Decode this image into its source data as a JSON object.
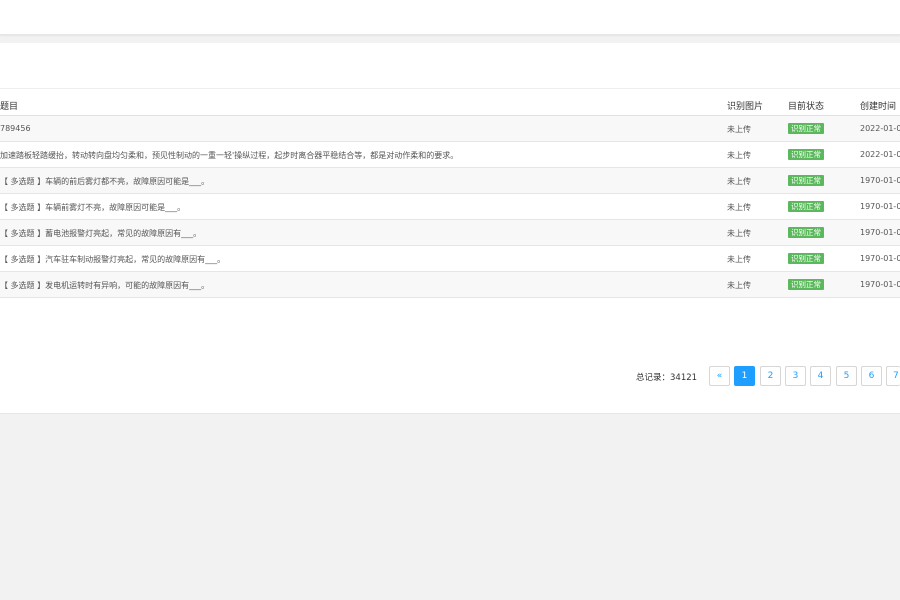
{
  "table": {
    "headers": {
      "title": "题目",
      "image": "识别图片",
      "status": "目前状态",
      "created": "创建时间"
    },
    "rows": [
      {
        "title": "789456",
        "image": "未上传",
        "status": "识别正常",
        "created": "2022-01-0"
      },
      {
        "title": "加速踏板轻踏缓抬，转动转向盘均匀柔和，预见性制动的一重一轻'操纵过程，起步时离合器平稳结合等，都是对动作柔和的要求。",
        "image": "未上传",
        "status": "识别正常",
        "created": "2022-01-0"
      },
      {
        "title": "【 多选题 】车辆的前后雾灯都不亮，故障原因可能是___。",
        "image": "未上传",
        "status": "识别正常",
        "created": "1970-01-0"
      },
      {
        "title": "【 多选题 】车辆前雾灯不亮，故障原因可能是___。",
        "image": "未上传",
        "status": "识别正常",
        "created": "1970-01-0"
      },
      {
        "title": "【 多选题 】蓄电池报警灯亮起，常见的故障原因有___。",
        "image": "未上传",
        "status": "识别正常",
        "created": "1970-01-0"
      },
      {
        "title": "【 多选题 】汽车驻车制动报警灯亮起，常见的故障原因有___。",
        "image": "未上传",
        "status": "识别正常",
        "created": "1970-01-0"
      },
      {
        "title": "【 多选题 】发电机运转时有异响，可能的故障原因有___。",
        "image": "未上传",
        "status": "识别正常",
        "created": "1970-01-0"
      }
    ]
  },
  "pagination": {
    "total_label": "总记录：34121",
    "prev": "«",
    "pages": [
      "1",
      "2",
      "3",
      "4",
      "5",
      "6",
      "7"
    ],
    "current": "1"
  },
  "colors": {
    "accent": "#1e9fff",
    "status_ok": "#5cb85c"
  }
}
